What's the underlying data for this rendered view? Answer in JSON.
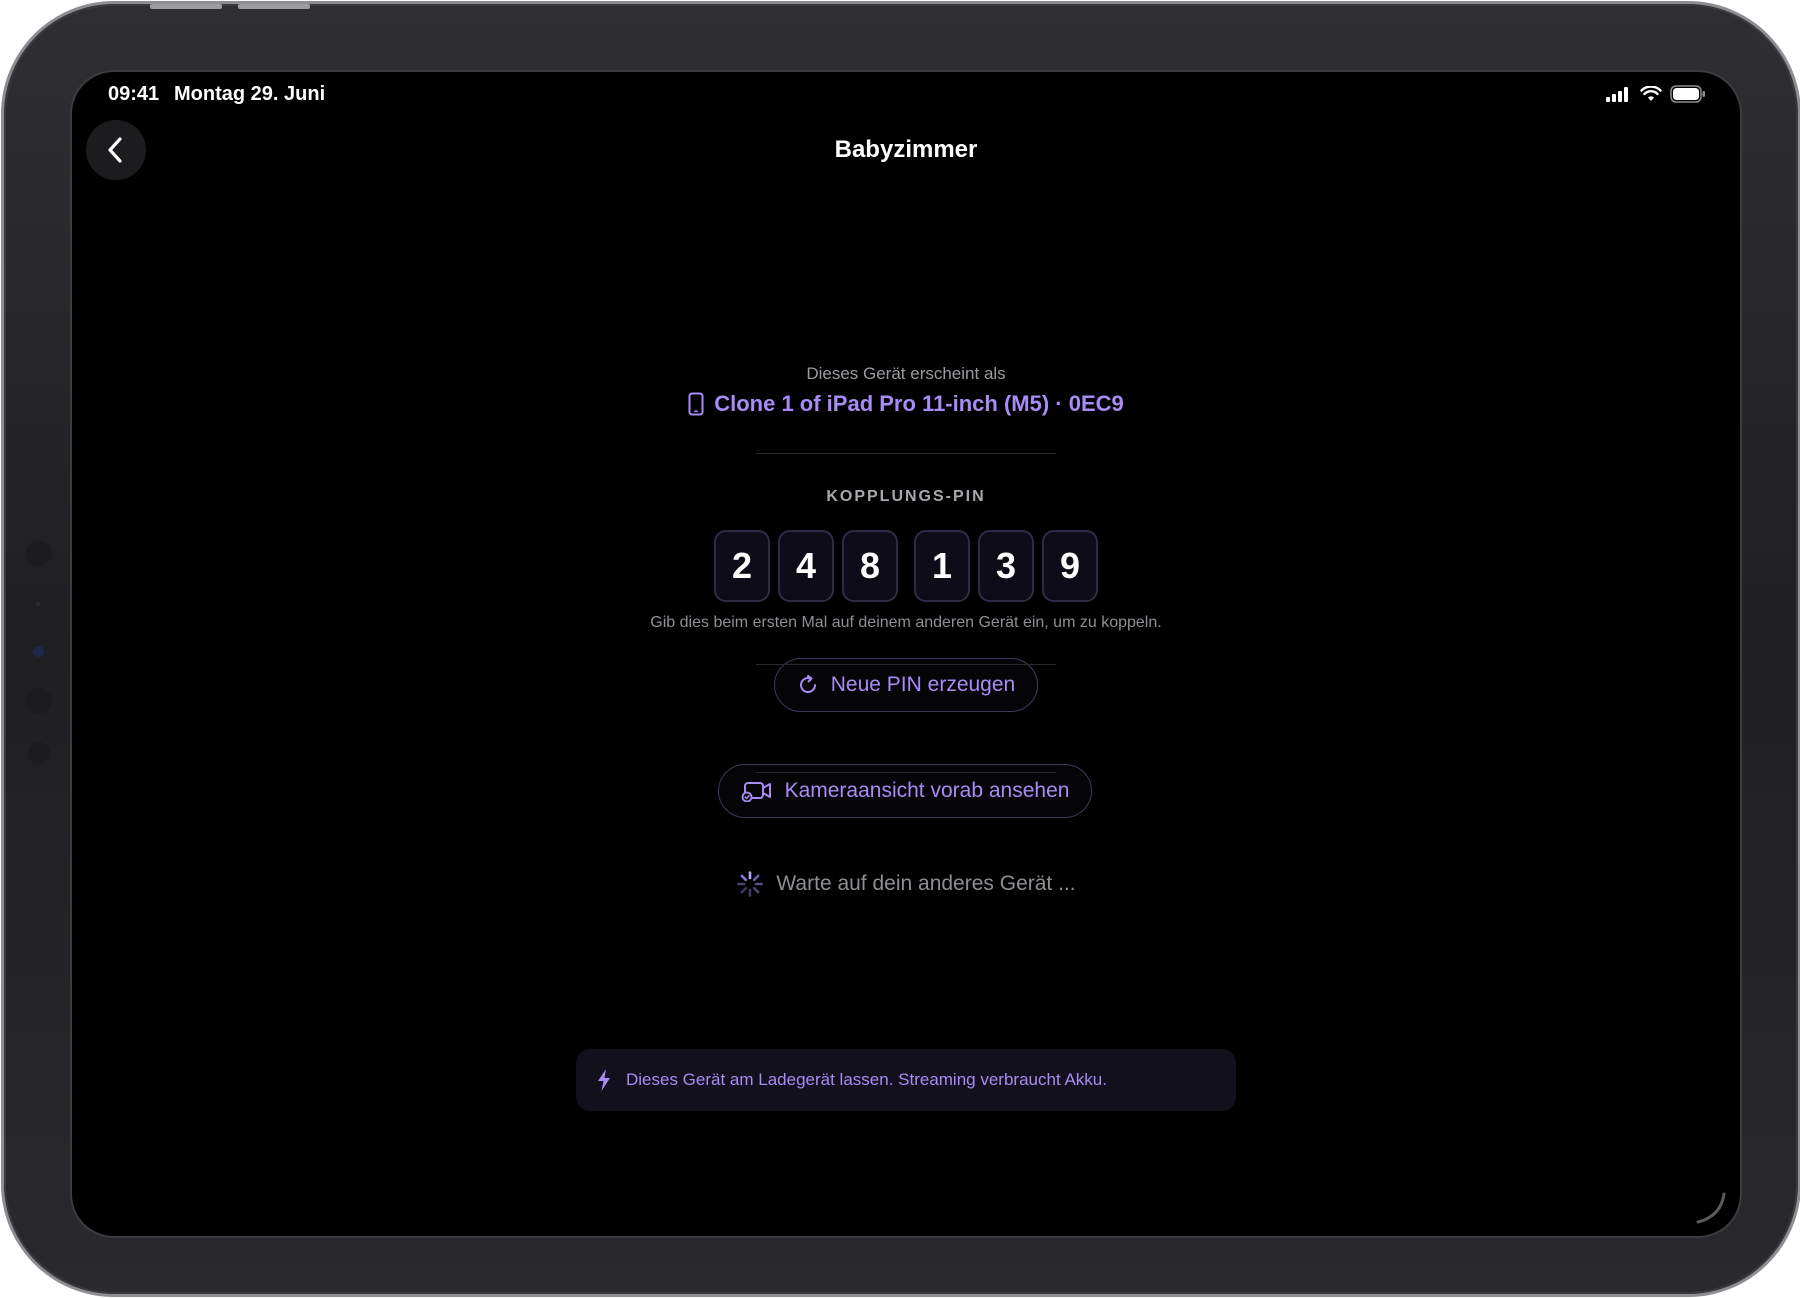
{
  "status_bar": {
    "time": "09:41",
    "date": "Montag 29. Juni"
  },
  "nav": {
    "title": "Babyzimmer",
    "back_icon": "chevron-left-icon"
  },
  "device_info": {
    "label": "Dieses Gerät erscheint als",
    "name": "Clone 1 of iPad Pro 11-inch (M5) · 0EC9",
    "icon": "tablet-icon"
  },
  "pairing": {
    "label": "KOPPLUNGS-PIN",
    "digits": [
      "2",
      "4",
      "8",
      "1",
      "3",
      "9"
    ],
    "hint": "Gib dies beim ersten Mal auf deinem anderen Gerät ein, um zu koppeln.",
    "new_pin_label": "Neue PIN erzeugen",
    "new_pin_icon": "refresh-icon"
  },
  "preview": {
    "label": "Kameraansicht vorab ansehen",
    "icon": "video-camera-icon"
  },
  "waiting": {
    "label": "Warte auf dein anderes Gerät ...",
    "icon": "spinner-icon"
  },
  "banner": {
    "text": "Dieses Gerät am Ladegerät lassen. Streaming verbraucht Akku.",
    "icon": "bolt-icon"
  },
  "colors": {
    "accent": "#a88bf5",
    "background": "#000000",
    "pin_box": "#0d0c18",
    "banner_bg": "#11101c"
  }
}
